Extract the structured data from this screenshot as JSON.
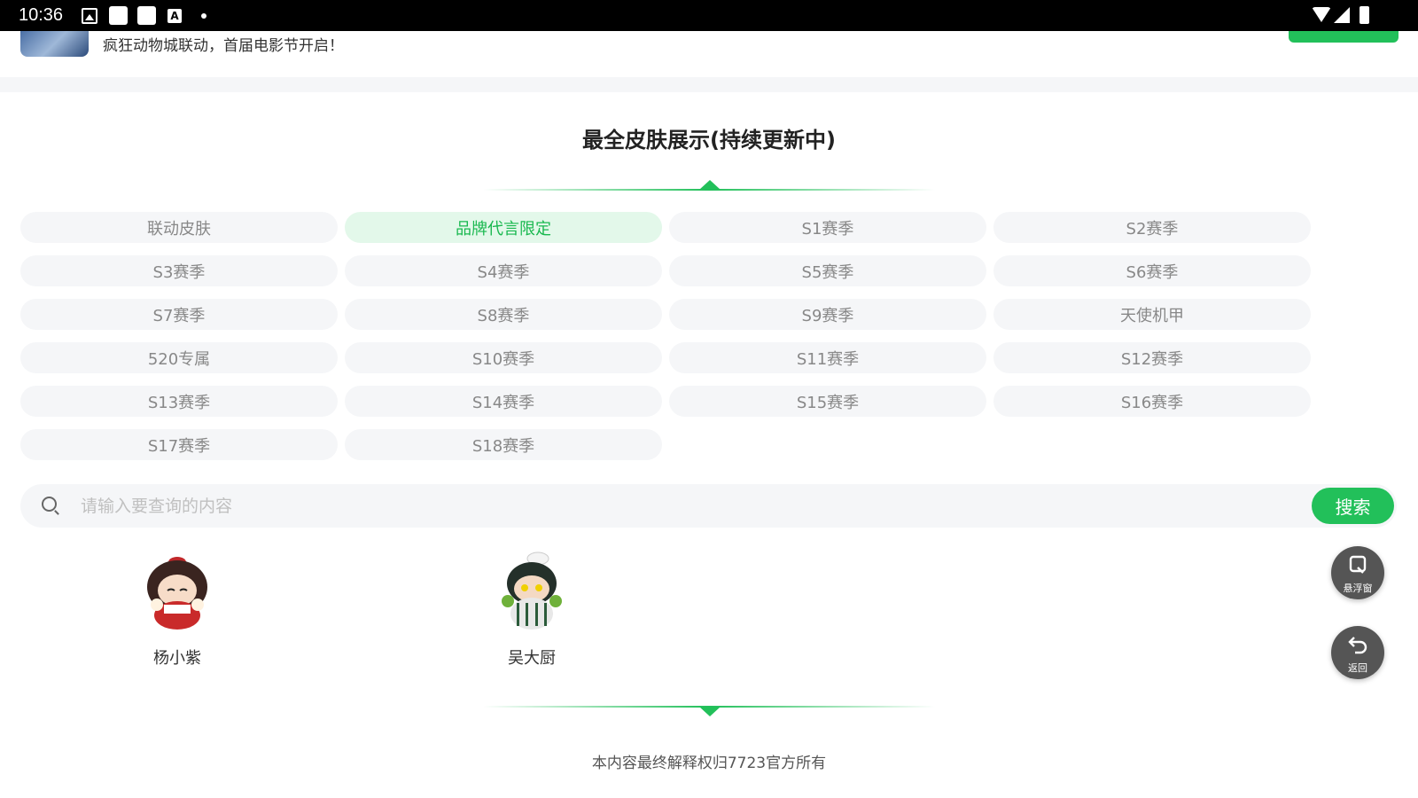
{
  "status_bar": {
    "time": "10:36"
  },
  "banner": {
    "text": "疯狂动物城联动，首届电影节开启！"
  },
  "section": {
    "title": "最全皮肤展示(持续更新中)"
  },
  "tabs": [
    {
      "label": "联动皮肤",
      "active": false
    },
    {
      "label": "品牌代言限定",
      "active": true
    },
    {
      "label": "S1赛季",
      "active": false
    },
    {
      "label": "S2赛季",
      "active": false
    },
    {
      "label": "S3赛季",
      "active": false
    },
    {
      "label": "S4赛季",
      "active": false
    },
    {
      "label": "S5赛季",
      "active": false
    },
    {
      "label": "S6赛季",
      "active": false
    },
    {
      "label": "S7赛季",
      "active": false
    },
    {
      "label": "S8赛季",
      "active": false
    },
    {
      "label": "S9赛季",
      "active": false
    },
    {
      "label": "天使机甲",
      "active": false
    },
    {
      "label": "520专属",
      "active": false
    },
    {
      "label": "S10赛季",
      "active": false
    },
    {
      "label": "S11赛季",
      "active": false
    },
    {
      "label": "S12赛季",
      "active": false
    },
    {
      "label": "S13赛季",
      "active": false
    },
    {
      "label": "S14赛季",
      "active": false
    },
    {
      "label": "S15赛季",
      "active": false
    },
    {
      "label": "S16赛季",
      "active": false
    },
    {
      "label": "S17赛季",
      "active": false
    },
    {
      "label": "S18赛季",
      "active": false
    }
  ],
  "search": {
    "placeholder": "请输入要查询的内容",
    "value": "",
    "button_label": "搜索"
  },
  "results": [
    {
      "name": "杨小紫",
      "icon": "character-avatar-yang-xiaozi"
    },
    {
      "name": "吴大厨",
      "icon": "character-avatar-wu-dachu"
    }
  ],
  "floating": {
    "float_window_label": "悬浮窗",
    "back_label": "返回"
  },
  "footer": {
    "text": "本内容最终解释权归7723官方所有"
  },
  "colors": {
    "accent": "#22c05a",
    "tab_bg": "#f5f6f8",
    "active_tab_bg": "#e3f8ea"
  }
}
